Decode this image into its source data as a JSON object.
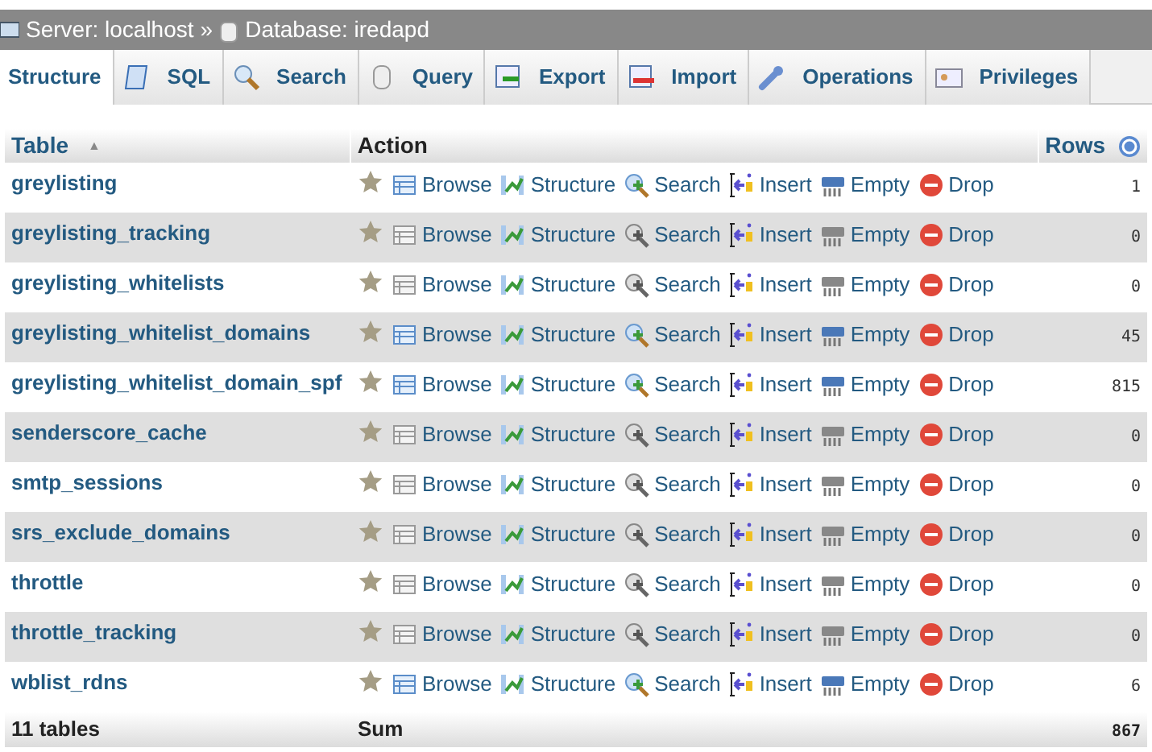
{
  "breadcrumb": {
    "server": "Server: localhost",
    "separator": "»",
    "database": "Database: iredapd"
  },
  "tabs": [
    {
      "label": "Structure",
      "selected": true
    },
    {
      "label": "SQL",
      "selected": false
    },
    {
      "label": "Search",
      "selected": false
    },
    {
      "label": "Query",
      "selected": false
    },
    {
      "label": "Export",
      "selected": false
    },
    {
      "label": "Import",
      "selected": false
    },
    {
      "label": "Operations",
      "selected": false
    },
    {
      "label": "Privileges",
      "selected": false
    }
  ],
  "table": {
    "columns": [
      "Table",
      "Action",
      "Rows"
    ],
    "sort_mark": "▲",
    "rows": [
      {
        "name": "greylisting",
        "rows": "1",
        "empty": false,
        "actions": [
          "Browse",
          "Structure",
          "Search",
          "Insert",
          "Empty",
          "Drop"
        ]
      },
      {
        "name": "greylisting_tracking",
        "rows": "0",
        "empty": true,
        "actions": [
          "Browse",
          "Structure",
          "Search",
          "Insert",
          "Empty",
          "Drop"
        ]
      },
      {
        "name": "greylisting_whitelists",
        "rows": "0",
        "empty": true,
        "actions": [
          "Browse",
          "Structure",
          "Search",
          "Insert",
          "Empty",
          "Drop"
        ]
      },
      {
        "name": "greylisting_whitelist_domains",
        "rows": "45",
        "empty": false,
        "actions": [
          "Browse",
          "Structure",
          "Search",
          "Insert",
          "Empty",
          "Drop"
        ]
      },
      {
        "name": "greylisting_whitelist_domain_spf",
        "rows": "815",
        "empty": false,
        "actions": [
          "Browse",
          "Structure",
          "Search",
          "Insert",
          "Empty",
          "Drop"
        ]
      },
      {
        "name": "senderscore_cache",
        "rows": "0",
        "empty": true,
        "actions": [
          "Browse",
          "Structure",
          "Search",
          "Insert",
          "Empty",
          "Drop"
        ]
      },
      {
        "name": "smtp_sessions",
        "rows": "0",
        "empty": true,
        "actions": [
          "Browse",
          "Structure",
          "Search",
          "Insert",
          "Empty",
          "Drop"
        ]
      },
      {
        "name": "srs_exclude_domains",
        "rows": "0",
        "empty": true,
        "actions": [
          "Browse",
          "Structure",
          "Search",
          "Insert",
          "Empty",
          "Drop"
        ]
      },
      {
        "name": "throttle",
        "rows": "0",
        "empty": true,
        "actions": [
          "Browse",
          "Structure",
          "Search",
          "Insert",
          "Empty",
          "Drop"
        ]
      },
      {
        "name": "throttle_tracking",
        "rows": "0",
        "empty": true,
        "actions": [
          "Browse",
          "Structure",
          "Search",
          "Insert",
          "Empty",
          "Drop"
        ]
      },
      {
        "name": "wblist_rdns",
        "rows": "6",
        "empty": false,
        "actions": [
          "Browse",
          "Structure",
          "Search",
          "Insert",
          "Empty",
          "Drop"
        ]
      }
    ],
    "footer": {
      "count": "11 tables",
      "label": "Sum",
      "total": "867"
    }
  }
}
